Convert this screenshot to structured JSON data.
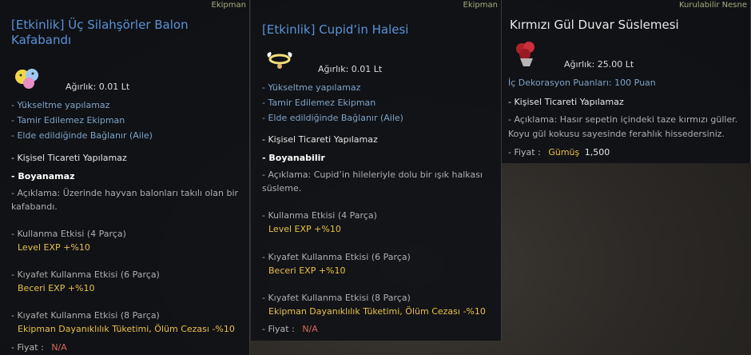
{
  "panels": [
    {
      "category": "Ekipman",
      "title_line1": "[Etkinlik] Üç Silahşörler Balon",
      "title_line2": "Kafabandı",
      "weight": "Ağırlık:   0.01 Lt",
      "lines_blue": [
        "- Yükseltme yapılamaz",
        "- Tamir Edilemez Ekipman",
        "- Elde edildiğinde Bağlanır (Aile)"
      ],
      "trade": "- Kişisel Ticareti Yapılamaz",
      "dye": "- Boyanamaz",
      "desc_line1": "- Açıklama: Üzerinde hayvan balonları takılı olan bir",
      "desc_line2": "kafabandı.",
      "effect1_label": "- Kullanma Etkisi (4 Parça)",
      "effect1_value": "Level EXP +%10",
      "effect2_label": "- Kıyafet Kullanma Etkisi (6 Parça)",
      "effect2_value": "Beceri EXP +%10",
      "effect3_label": "- Kıyafet Kullanma Etkisi (8 Parça)",
      "effect3_value": "Ekipman Dayanıklılık Tüketimi, Ölüm Cezası -%10",
      "price_label": "- Fiyat :",
      "price_value": "N/A"
    },
    {
      "category": "Ekipman",
      "title_line1": "[Etkinlik] Cupid’in Halesi",
      "weight": "Ağırlık:   0.01 Lt",
      "lines_blue": [
        "- Yükseltme yapılamaz",
        "- Tamir Edilemez Ekipman",
        "- Elde edildiğinde Bağlanır (Aile)"
      ],
      "trade": "- Kişisel Ticareti Yapılamaz",
      "dye": "- Boyanabilir",
      "desc_line1": "- Açıklama: Cupid’in hileleriyle dolu bir ışık halkası",
      "desc_line2": "süsleme.",
      "effect1_label": "- Kullanma Etkisi (4 Parça)",
      "effect1_value": "Level EXP +%10",
      "effect2_label": "- Kıyafet Kullanma Etkisi (6 Parça)",
      "effect2_value": "Beceri EXP +%10",
      "effect3_label": "- Kıyafet Kullanma Etkisi (8 Parça)",
      "effect3_value": "Ekipman Dayanıklılık Tüketimi, Ölüm Cezası -%10",
      "price_label": "- Fiyat :",
      "price_value": "N/A"
    },
    {
      "category": "Kurulabilir Nesne",
      "title_line1": "Kırmızı Gül Duvar Süslemesi",
      "weight": "Ağırlık:   25.00 Lt",
      "decor": "İç Dekorasyon Puanları: 100 Puan",
      "trade": "- Kişisel Ticareti Yapılamaz",
      "desc_line1": "- Açıklama: Hasır sepetin içindeki taze kırmızı güller.",
      "desc_line2": "Koyu gül kokusu sayesinde ferahlık hissedersiniz.",
      "price_label": "- Fiyat :",
      "price_currency": "Gümüş",
      "price_value": "1,500"
    }
  ],
  "icons": [
    "balloon-headband-icon",
    "cupid-halo-icon",
    "rose-basket-icon"
  ]
}
